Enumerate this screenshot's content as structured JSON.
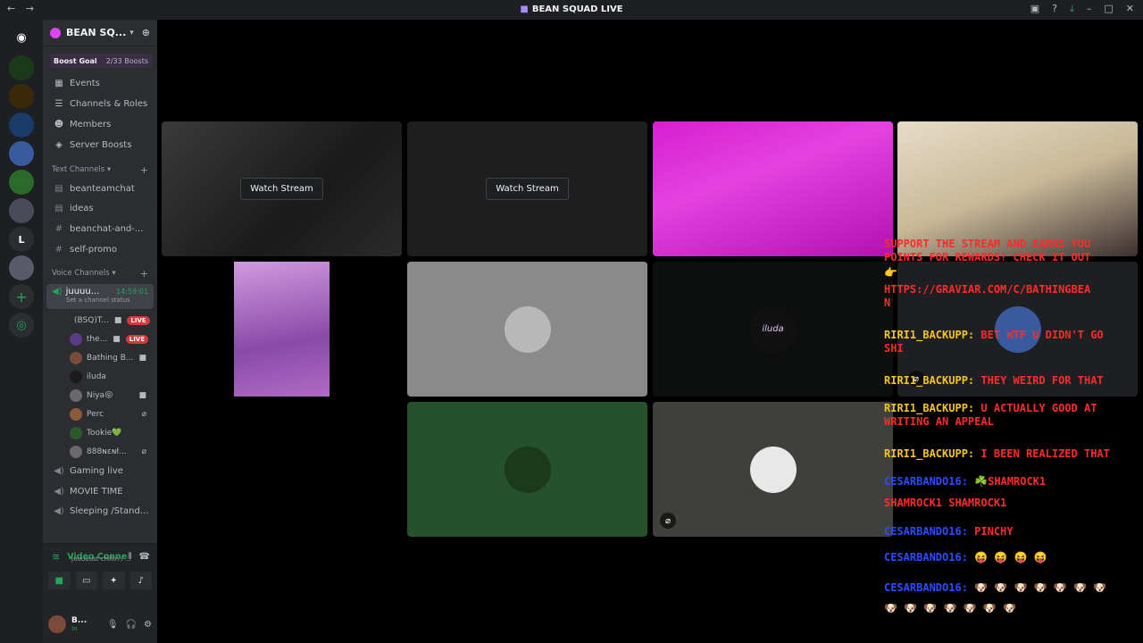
{
  "window": {
    "title": "BEAN SQUAD LIVE",
    "back": "←",
    "forward": "→"
  },
  "guilds": {
    "discord_glyph": "◉",
    "letter_server": "L",
    "add_glyph": "+",
    "discover_glyph": "◎"
  },
  "server": {
    "name": "BEAN SQ...",
    "boost_label": "Boost Goal",
    "boost_count": "2/33 Boosts"
  },
  "menu": [
    {
      "icon": "calendar-icon",
      "glyph": "▦",
      "label": "Events"
    },
    {
      "icon": "channels-icon",
      "glyph": "☰",
      "label": "Channels & Roles"
    },
    {
      "icon": "members-icon",
      "glyph": "☻",
      "label": "Members"
    },
    {
      "icon": "boost-icon",
      "glyph": "◈",
      "label": "Server Boosts"
    }
  ],
  "text_category": "Text Channels",
  "text_channels": [
    {
      "glyph": "▤",
      "label": "beanteamchat"
    },
    {
      "glyph": "▤",
      "label": "ideas"
    },
    {
      "glyph": "#",
      "label": "beanchat-and-..."
    },
    {
      "glyph": "#",
      "label": "self-promo"
    }
  ],
  "voice_category": "Voice Channels",
  "active_voice": {
    "name": "juuuu...",
    "time": "14:59:01",
    "status_placeholder": "Set a channel status"
  },
  "voice_users": [
    {
      "name": "(BSQ)T...",
      "badge": "LIVE",
      "color": "#6a6a6a"
    },
    {
      "name": "the...",
      "badge": "LIVE",
      "color": "#5b3a8a"
    },
    {
      "name": "Bathing B...",
      "badge": "",
      "color": "#7a4a3a"
    },
    {
      "name": "iluda",
      "badge": "",
      "color": "#1a1a1a"
    },
    {
      "name": "Niya😝",
      "badge": "",
      "color": "#6a6a6a"
    },
    {
      "name": "Perc",
      "badge": "",
      "color": "#8a5a3a"
    },
    {
      "name": "Tookie💚",
      "badge": "",
      "color": "#2a5a2a"
    },
    {
      "name": "888ɴɛɴł...",
      "badge": "",
      "color": "#6a6a6a"
    }
  ],
  "other_voice": [
    "Gaming live",
    "MOVIE TIME",
    "Sleeping /Stand..."
  ],
  "connection": {
    "status": "Video Connected",
    "channel": "juuuuust chillin / ..."
  },
  "user": {
    "name": "B...",
    "status": "In"
  },
  "stage": {
    "watch_label": "Watch Stream",
    "tile_avatar_iluda": "iluda"
  },
  "overlay": [
    {
      "cls": "red",
      "text": "SUPPORT THE STREAM AND EARNS YOU"
    },
    {
      "cls": "red",
      "text": "POINTS FOR REWARDS! CHECK IT OUT"
    },
    {
      "cls": "emo",
      "text": "👉"
    },
    {
      "cls": "red",
      "text": "HTTPS://GRAVIAR.COM/C/BATHINGBEA"
    },
    {
      "cls": "red",
      "text": "N"
    },
    {
      "cls": "mix",
      "user": "RIRI1_BACKUPP:",
      "msg": "BET WTF U DIDN'T GO"
    },
    {
      "cls": "red",
      "text": "SHI"
    },
    {
      "cls": "mix",
      "user": "RIRI1_BACKUPP:",
      "msg": "THEY WEIRD FOR THAT"
    },
    {
      "cls": "mix",
      "user": "RIRI1_BACKUPP:",
      "msg": "U ACTUALLY GOOD AT"
    },
    {
      "cls": "red",
      "text": "WRITING AN APPEAL"
    },
    {
      "cls": "mix",
      "user": "RIRI1_BACKUPP:",
      "msg": "I BEEN REALIZED THAT"
    },
    {
      "cls": "mixb",
      "user": "CESARBANDO16:",
      "msg": "☘️SHAMROCK1"
    },
    {
      "cls": "red",
      "text": "SHAMROCK1 SHAMROCK1"
    },
    {
      "cls": "mixb",
      "user": "CESARBANDO16:",
      "msg": "PINCHY"
    },
    {
      "cls": "mixb",
      "user": "CESARBANDO16:",
      "msg": "😝 😝 😝 😝"
    },
    {
      "cls": "mixb",
      "user": "CESARBANDO16:",
      "msg": "🐶 🐶 🐶 🐶 🐶 🐶 🐶"
    },
    {
      "cls": "emo",
      "text": "🐶 🐶 🐶 🐶 🐶 🐶 🐶"
    }
  ]
}
